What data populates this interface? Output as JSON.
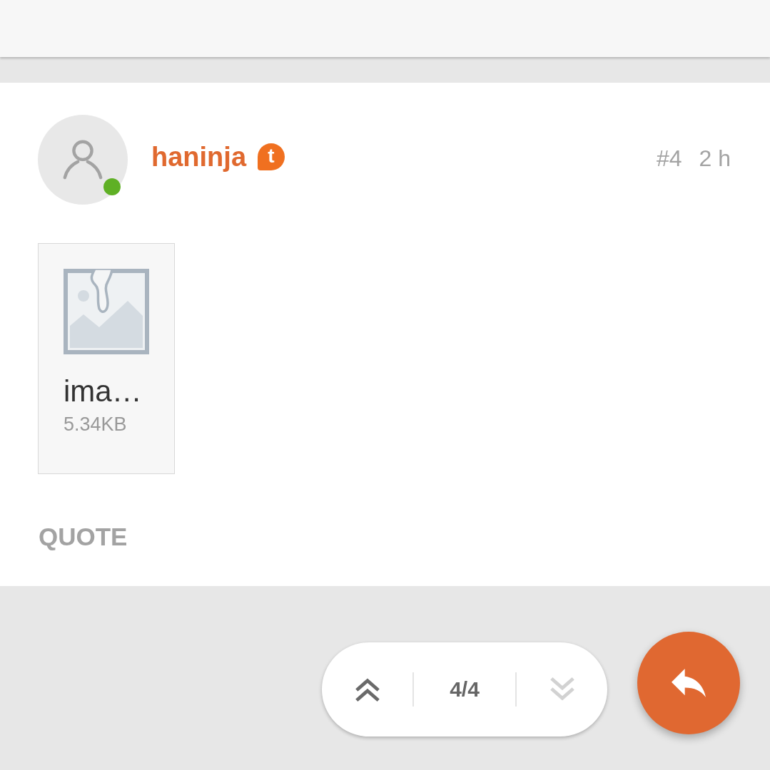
{
  "post": {
    "author": {
      "name": "haninja",
      "online": true,
      "badge": "t"
    },
    "number": "#4",
    "time": "2 h",
    "attachments": [
      {
        "name": "ima…",
        "size": "5.34KB"
      }
    ],
    "actions": [
      "QUOTE"
    ]
  },
  "pager": {
    "previous": {
      "disabled": false
    },
    "position": "4/4",
    "next": {
      "disabled": true
    }
  }
}
